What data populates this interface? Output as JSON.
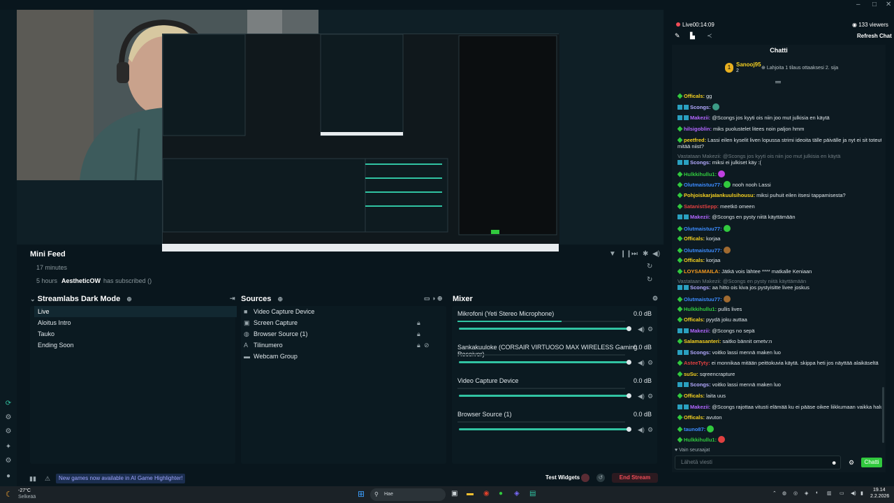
{
  "titlebar": {
    "minimize": "–",
    "maximize": "□",
    "close": "✕"
  },
  "preview": {
    "screen": {
      "chat_title": "Chatti",
      "notif_text": "New games now available in AI Game Highlighter",
      "btn_test": "Test Widgets",
      "btn_end": "End Stream"
    }
  },
  "mini_feed": {
    "title": "Mini Feed",
    "items": [
      {
        "time": "17 minutes",
        "user": "",
        "text": ""
      },
      {
        "time": "5 hours",
        "user": "AestheticOW",
        "text": "has subscribed ()"
      }
    ]
  },
  "scenes": {
    "title": "Streamlabs Dark Mode",
    "items": [
      "Live",
      "Aloitus Intro",
      "Tauko",
      "Ending Soon"
    ]
  },
  "sources": {
    "title": "Sources",
    "items": [
      {
        "label": "Video Capture Device",
        "icon": "camera-icon"
      },
      {
        "label": "Screen Capture",
        "icon": "screen-icon"
      },
      {
        "label": "Browser Source (1)",
        "icon": "globe-icon"
      },
      {
        "label": "Tilinumero",
        "icon": "text-icon"
      },
      {
        "label": "Webcam Group",
        "icon": "folder-icon"
      }
    ]
  },
  "mixer": {
    "title": "Mixer",
    "items": [
      {
        "label": "Mikrofoni (Yeti Stereo Microphone)",
        "db": "0.0 dB",
        "level": 0.62
      },
      {
        "label": "Sankakuuloke (CORSAIR VIRTUOSO MAX WIRELESS Gaming Receiver)",
        "db": "0.0 dB",
        "level": 0.0
      },
      {
        "label": "Video Capture Device",
        "db": "0.0 dB",
        "level": 0.0
      },
      {
        "label": "Browser Source (1)",
        "db": "0.0 dB",
        "level": 0.0
      }
    ]
  },
  "footer": {
    "notif": "New games now available in AI Game Highlighter!",
    "test_widgets": "Test Widgets",
    "end_stream": "End Stream"
  },
  "stream": {
    "live_label": "Live",
    "time": "00:14:09",
    "viewers": "133 viewers",
    "refresh": "Refresh Chat"
  },
  "chat": {
    "title": "Chatti",
    "top_gifter": "Sanooj95",
    "top_gifter_count": "2",
    "gift_prompt": "Lahjoita 1 tilaus ottaaksesi 2. sija",
    "lines": [
      {
        "user": "Officals:",
        "color": "#f5d020",
        "text": "gg",
        "badge": ""
      },
      {
        "user": "Scongs:",
        "color": "#b4aaff",
        "text": "",
        "badge": "double",
        "emote": "#3c9b86"
      },
      {
        "user": "Makezii:",
        "color": "#b266ff",
        "text": "@Scongs jos kyyti ois niin joo mut julkisia en käytä",
        "badge": "double"
      },
      {
        "user": "hilsigoblin:",
        "color": "#b266ff",
        "text": "miks puolustelet litees noin paljon hmm",
        "badge": ""
      },
      {
        "user": "peetfred:",
        "color": "#f5d020",
        "text": "Lassi eilen kyselit liven lopussa strimi ideoita tälle päivälle ja nyt ei sit toteutetakaa",
        "badge": ""
      },
      {
        "user": "",
        "color": "#dfe6ea",
        "text": "mitää niist?",
        "badge": ""
      },
      {
        "user": "",
        "color": "#717d83",
        "text": "Vastataan Makezii: @Scongs jos kyyti ois niin joo mut julkisia en käytä",
        "badge": "",
        "reply": true
      },
      {
        "user": "Scongs:",
        "color": "#b4aaff",
        "text": "miksi ei julkiset käy :(",
        "badge": "double"
      },
      {
        "user": "Hulkkihullu1:",
        "color": "#31c93e",
        "text": "",
        "badge": "",
        "emote": "#c040e0"
      },
      {
        "user": "Olutmaistuu77:",
        "color": "#3c8cff",
        "text": "nooh nooh Lassi",
        "badge": "",
        "emote": "#31c93e"
      },
      {
        "user": "PohjoiskarjaIankuulsihousu:",
        "color": "#f5d020",
        "text": "miksi puhuit eilen itsesi tappamisesta?",
        "badge": ""
      },
      {
        "user": "SatanistSepp:",
        "color": "#e04040",
        "text": "meetkö omeen",
        "badge": ""
      },
      {
        "user": "Makezii:",
        "color": "#b266ff",
        "text": "@Scongs en pysty niitä käyttämään",
        "badge": "double"
      },
      {
        "user": "Olutmaistuu77:",
        "color": "#3c8cff",
        "text": "",
        "badge": "",
        "emote": "#31c93e"
      },
      {
        "user": "Officals:",
        "color": "#f5d020",
        "text": "korjaa",
        "badge": ""
      },
      {
        "user": "Olutmaistuu77:",
        "color": "#3c8cff",
        "text": "",
        "badge": "",
        "emote": "#a06a30"
      },
      {
        "user": "Officals:",
        "color": "#f5d020",
        "text": "korjaa",
        "badge": ""
      },
      {
        "user": "LOYSAMAILA:",
        "color": "#f59a20",
        "text": "Jätkä vois lähtee **** matkalle Keniaan",
        "badge": ""
      },
      {
        "user": "",
        "color": "#717d83",
        "text": "Vastataan Makezii: @Scongs en pysty niitä käyttämään",
        "badge": "",
        "reply": true
      },
      {
        "user": "Scongs:",
        "color": "#b4aaff",
        "text": "aa hitto ois kiva jos pystyisitte livee joskus",
        "badge": "double"
      },
      {
        "user": "Olutmaistuu77:",
        "color": "#3c8cff",
        "text": "",
        "badge": "",
        "emote": "#a06a30"
      },
      {
        "user": "Hulkkihullu1:",
        "color": "#31c93e",
        "text": "pullis lives",
        "badge": ""
      },
      {
        "user": "Officals:",
        "color": "#f5d020",
        "text": "pyydä joku auttaa",
        "badge": ""
      },
      {
        "user": "Makezii:",
        "color": "#b266ff",
        "text": "@Scongs no sepä",
        "badge": "double"
      },
      {
        "user": "Salamasanteri:",
        "color": "#f5d020",
        "text": "saitko bännit ometv:n",
        "badge": ""
      },
      {
        "user": "Scongs:",
        "color": "#b4aaff",
        "text": "voitko lassi mennä maken luo",
        "badge": "double"
      },
      {
        "user": "AsteeTyty:",
        "color": "#e04040",
        "text": "ei monnikaa mitään peittokuvia käytä. skippa heti jos näyttää alaikäseltä",
        "badge": ""
      },
      {
        "user": "suSu:",
        "color": "#f5d020",
        "text": "sqreencrapture",
        "badge": ""
      },
      {
        "user": "Scongs:",
        "color": "#b4aaff",
        "text": "voitko lassi mennä maken luo",
        "badge": "double"
      },
      {
        "user": "Officals:",
        "color": "#f5d020",
        "text": "laita uus",
        "badge": ""
      },
      {
        "user": "Makezii:",
        "color": "#b266ff",
        "text": "@Scongs rajottaa vitusti elämää ku ei pääse oikee liikkumaan vaikka haluais",
        "badge": "double"
      },
      {
        "user": "Officals:",
        "color": "#f5d020",
        "text": "avuton",
        "badge": ""
      },
      {
        "user": "tauno87:",
        "color": "#3c8cff",
        "text": "",
        "badge": "",
        "emote": "#31c93e"
      },
      {
        "user": "Hulkkihullu1:",
        "color": "#31c93e",
        "text": "",
        "badge": "",
        "emote": "#e04040"
      }
    ],
    "followers_only": "Vain seuraajat",
    "input_placeholder": "Lähetä viesti",
    "send": "Chatti"
  },
  "taskbar": {
    "weather_temp": "-27°C",
    "weather_desc": "Selkeää",
    "search_placeholder": "Hae",
    "time": "19.14",
    "date": "2.2.2026"
  },
  "colors": {
    "accent": "#31c3a2",
    "live_red": "#f04c57",
    "send_green": "#31c93e"
  }
}
